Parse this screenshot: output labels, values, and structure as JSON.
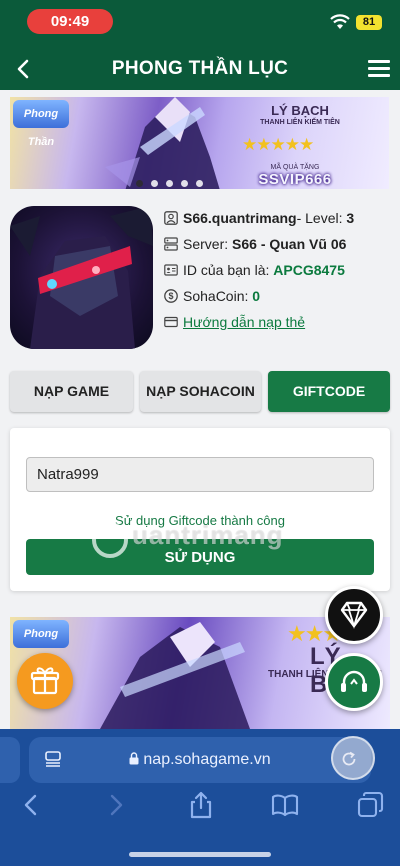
{
  "status_bar": {
    "time": "09:49",
    "battery": "81"
  },
  "nav": {
    "title": "PHONG THẦN LỤC"
  },
  "banner": {
    "logo": "Phong Thần",
    "character": "LÝ BẠCH",
    "tagline": "THANH LIÊN KIẾM TIÊN",
    "stars": "★★★★★",
    "promo_label": "MÃ QUÀ TẶNG",
    "promo_code": "SSVIP666"
  },
  "profile": {
    "username": "S66.quantrimang",
    "level_label": "- Level:",
    "level": "3",
    "server_label": "Server:",
    "server": "S66 - Quan Vũ 06",
    "id_label": "ID của bạn là:",
    "id": "APCG8475",
    "sohacoin_label": "SohaCoin:",
    "sohacoin": "0",
    "guide_link": "Hướng dẫn nạp thẻ"
  },
  "tabs": [
    {
      "label": "NẠP GAME"
    },
    {
      "label": "NẠP SOHACOIN"
    },
    {
      "label": "GIFTCODE"
    }
  ],
  "giftcode": {
    "value": "Natra999",
    "success_message": "Sử dụng Giftcode thành công",
    "button_label": "SỬ DỤNG"
  },
  "watermark": "uantrimang",
  "banner2": {
    "character": "LÝ BẠCH",
    "tagline": "THANH LIÊN KIẾM TIÊN",
    "stars": "★★★"
  },
  "browser": {
    "url": "nap.sohagame.vn"
  },
  "colors": {
    "primary_green": "#177a45",
    "header_green": "#0b5a3a",
    "safari_blue": "#1c4e9a",
    "gift_orange": "#f59a1f"
  }
}
